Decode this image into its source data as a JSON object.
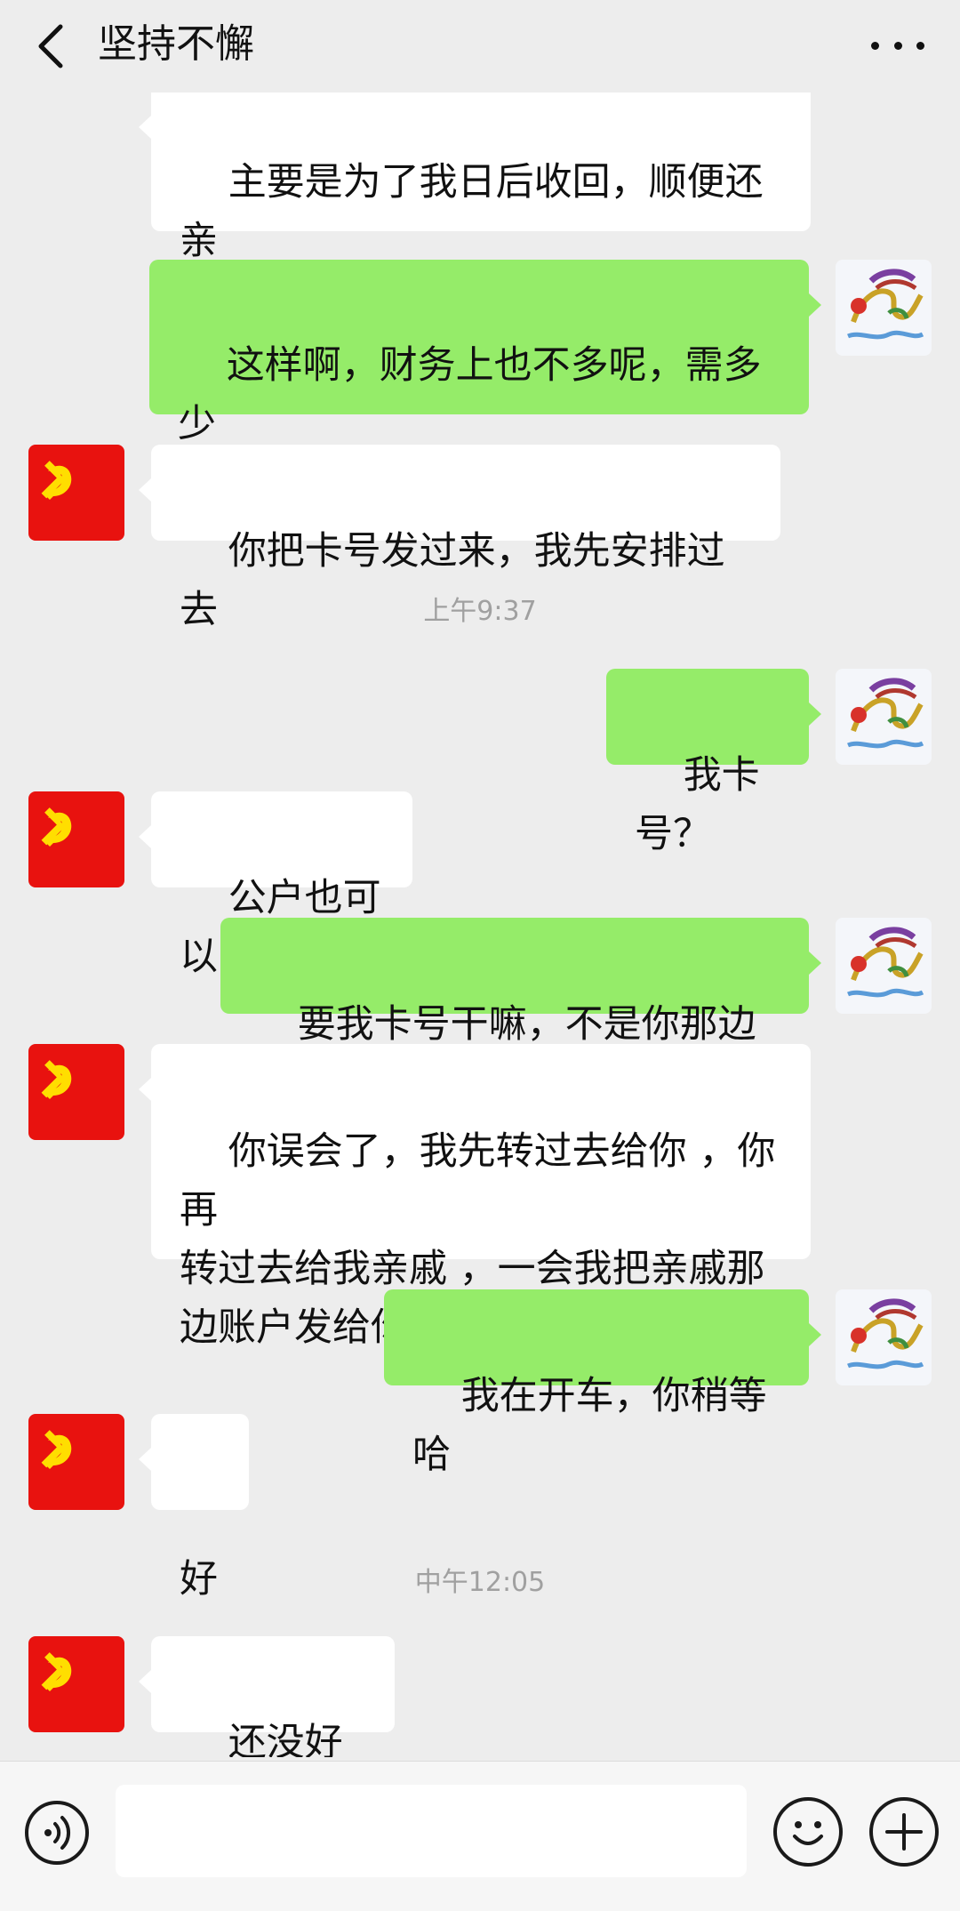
{
  "header": {
    "title": "坚持不懈"
  },
  "messages": [
    {
      "from": "them",
      "text": "主要是为了我日后收回，顺便还亲\n戚一个人情，你看方便吗？"
    },
    {
      "from": "me",
      "text": "这样啊，财务上也不多呢，需多少\n呢"
    },
    {
      "from": "them",
      "text": "你把卡号发过来，我先安排过去"
    },
    {
      "timestamp": "上午9:37"
    },
    {
      "from": "me",
      "text": "我卡号？"
    },
    {
      "from": "them",
      "text": "公户也可以"
    },
    {
      "from": "me",
      "text": "要我卡号干嘛，不是你那边吗"
    },
    {
      "from": "them",
      "text": "你误会了，我先转过去给你 ，你再\n转过去给我亲戚 ，一会我把亲戚那\n边账户发给你"
    },
    {
      "from": "me",
      "text": "我在开车，你稍等哈"
    },
    {
      "from": "them",
      "text": "好"
    },
    {
      "timestamp": "中午12:05"
    },
    {
      "from": "them",
      "text": "还没好吗？"
    }
  ],
  "input": {
    "value": ""
  },
  "icons": {
    "back": "chevron-left-icon",
    "more": "more-dots-icon",
    "voice": "voice-icon",
    "emoji": "emoji-icon",
    "plus": "plus-icon",
    "contact_avatar": "hammer-sickle-flag",
    "own_avatar": "dragon-image"
  },
  "colors": {
    "background": "#ededed",
    "incoming_bubble": "#ffffff",
    "outgoing_bubble": "#95ec69",
    "timestamp": "#a0a0a0",
    "flag_red": "#e8120f",
    "flag_yellow": "#ffde00"
  }
}
